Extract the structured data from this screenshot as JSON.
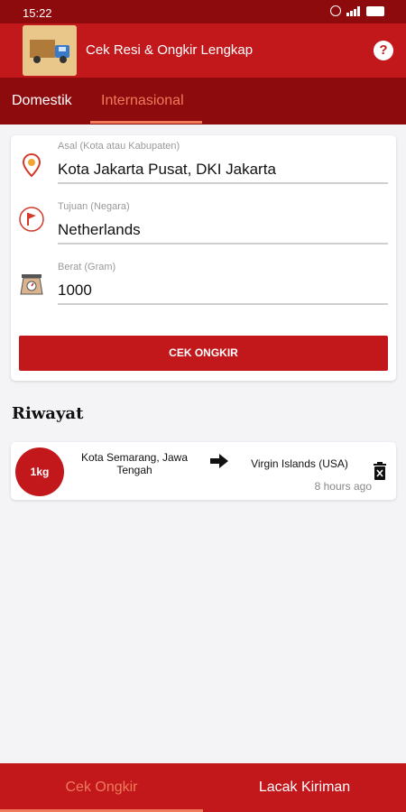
{
  "status_bar": {
    "time": "15:22",
    "icons": [
      "alarm-icon",
      "signal-icon",
      "battery-icon"
    ]
  },
  "app_bar": {
    "title": "Cek Resi & Ongkir Lengkap",
    "help_icon": "help-icon",
    "help_symbol": "?"
  },
  "tabs": [
    {
      "label": "Domestik",
      "active": false
    },
    {
      "label": "Internasional",
      "active": true
    }
  ],
  "form": {
    "origin": {
      "label": "Asal (Kota atau Kabupaten)",
      "value": "Kota Jakarta Pusat, DKI Jakarta",
      "icon": "location-pin-icon"
    },
    "destination": {
      "label": "Tujuan (Negara)",
      "value": "Netherlands",
      "icon": "flag-icon"
    },
    "weight": {
      "label": "Berat (Gram)",
      "value": "1000",
      "icon": "scale-icon"
    },
    "submit_label": "CEK ONGKIR"
  },
  "history": {
    "title": "Riwayat",
    "items": [
      {
        "weight": "1kg",
        "origin": "Kota Semarang, Jawa Tengah",
        "destination": "Virgin Islands (USA)",
        "time": "8 hours ago",
        "arrow_icon": "arrow-right-icon",
        "delete_icon": "delete-icon"
      }
    ]
  },
  "bottom_nav": [
    {
      "label": "Cek Ongkir",
      "active": true
    },
    {
      "label": "Lacak Kiriman",
      "active": false
    }
  ],
  "colors": {
    "primary": "#c2181c",
    "primary_dark": "#8e0b0d",
    "accent": "#f07a5a",
    "background": "#f4f4f7"
  }
}
